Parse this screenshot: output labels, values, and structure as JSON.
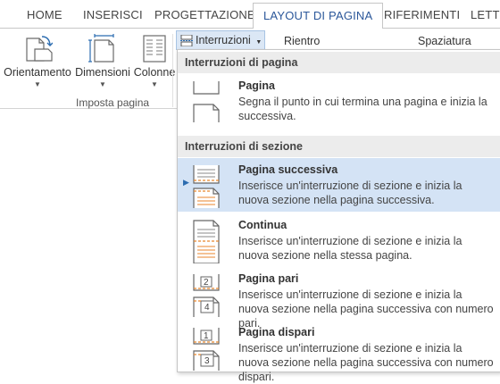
{
  "tabs": [
    {
      "label": "HOME"
    },
    {
      "label": "INSERISCI"
    },
    {
      "label": "PROGETTAZIONE"
    },
    {
      "label": "LAYOUT DI PAGINA"
    },
    {
      "label": "RIFERIMENTI"
    },
    {
      "label": "LETTE"
    }
  ],
  "ribbon": {
    "orientamento": "Orientamento",
    "dimensioni": "Dimensioni",
    "colonne": "Colonne",
    "group_label": "Imposta pagina",
    "interruzioni": "Interruzioni",
    "rientro": "Rientro",
    "spaziatura": "Spaziatura"
  },
  "menu": {
    "section_page": "Interruzioni di pagina",
    "section_section": "Interruzioni di sezione",
    "items": [
      {
        "title": "Pagina",
        "desc": "Segna il punto in cui termina una pagina e inizia la successiva.",
        "icon": "page-break-icon"
      },
      {
        "title": "Pagina successiva",
        "desc": "Inserisce un'interruzione di sezione e inizia la nuova sezione nella pagina successiva.",
        "icon": "next-page-break-icon"
      },
      {
        "title": "Continua",
        "desc": "Inserisce un'interruzione di sezione e inizia la nuova sezione nella stessa pagina.",
        "icon": "continuous-break-icon"
      },
      {
        "title": "Pagina pari",
        "desc": "Inserisce un'interruzione di sezione e inizia la nuova sezione nella pagina successiva con numero pari.",
        "icon": "even-page-break-icon"
      },
      {
        "title": "Pagina dispari",
        "desc": "Inserisce un'interruzione di sezione e inizia la nuova sezione nella pagina successiva con numero dispari.",
        "icon": "odd-page-break-icon"
      }
    ],
    "even_number": "2",
    "even_number_next": "4",
    "odd_number": "1",
    "odd_number_next": "3"
  },
  "colors": {
    "accent": "#2b579a",
    "highlight": "#d4e3f5",
    "section_bg": "#ececec",
    "icon_orange": "#e8862e"
  }
}
